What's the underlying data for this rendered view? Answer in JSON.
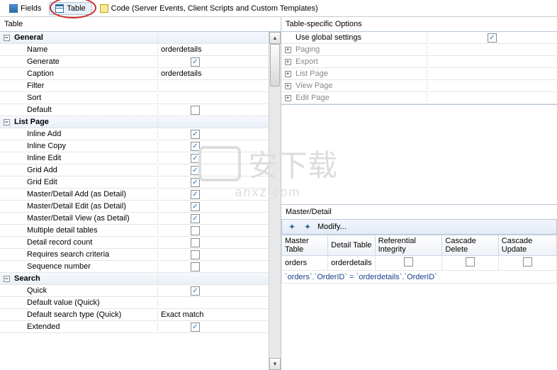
{
  "tabs": {
    "fields": "Fields",
    "table": "Table",
    "code": "Code (Server Events, Client Scripts and Custom Templates)"
  },
  "left": {
    "title": "Table",
    "groups": [
      {
        "label": "General",
        "rows": [
          {
            "name": "Name",
            "value": "orderdetails"
          },
          {
            "name": "Generate",
            "check": true
          },
          {
            "name": "Caption",
            "value": "orderdetails"
          },
          {
            "name": "Filter",
            "value": ""
          },
          {
            "name": "Sort",
            "value": ""
          },
          {
            "name": "Default",
            "check": false
          }
        ]
      },
      {
        "label": "List Page",
        "rows": [
          {
            "name": "Inline Add",
            "check": true
          },
          {
            "name": "Inline Copy",
            "check": true
          },
          {
            "name": "Inline Edit",
            "check": true
          },
          {
            "name": "Grid Add",
            "check": true
          },
          {
            "name": "Grid Edit",
            "check": true
          },
          {
            "name": "Master/Detail Add (as Detail)",
            "check": true
          },
          {
            "name": "Master/Detail Edit (as Detail)",
            "check": true
          },
          {
            "name": "Master/Detail View (as Detail)",
            "check": true
          },
          {
            "name": "Multiple detail tables",
            "check": false
          },
          {
            "name": "Detail record count",
            "check": false
          },
          {
            "name": "Requires search criteria",
            "check": false
          },
          {
            "name": "Sequence number",
            "check": false
          }
        ]
      },
      {
        "label": "Search",
        "rows": [
          {
            "name": "Quick",
            "check": true
          },
          {
            "name": "Default value (Quick)",
            "value": ""
          },
          {
            "name": "Default search type (Quick)",
            "value": "Exact match"
          },
          {
            "name": "Extended",
            "check": true
          }
        ]
      }
    ]
  },
  "right": {
    "title": "Table-specific Options",
    "global": {
      "label": "Use global settings",
      "check": true
    },
    "sections": [
      "Paging",
      "Export",
      "List Page",
      "View Page",
      "Edit Page"
    ]
  },
  "md": {
    "title": "Master/Detail",
    "modify": "Modify...",
    "headers": [
      "Master Table",
      "Detail Table",
      "Referential Integrity",
      "Cascade Delete",
      "Cascade Update"
    ],
    "row": {
      "master": "orders",
      "detail": "orderdetails",
      "ri": false,
      "cd": false,
      "cu": false
    },
    "sql": "`orders`.`OrderID` = `orderdetails`.`OrderID`"
  },
  "watermark": {
    "main": "安下载",
    "sub": "anxz.com"
  }
}
